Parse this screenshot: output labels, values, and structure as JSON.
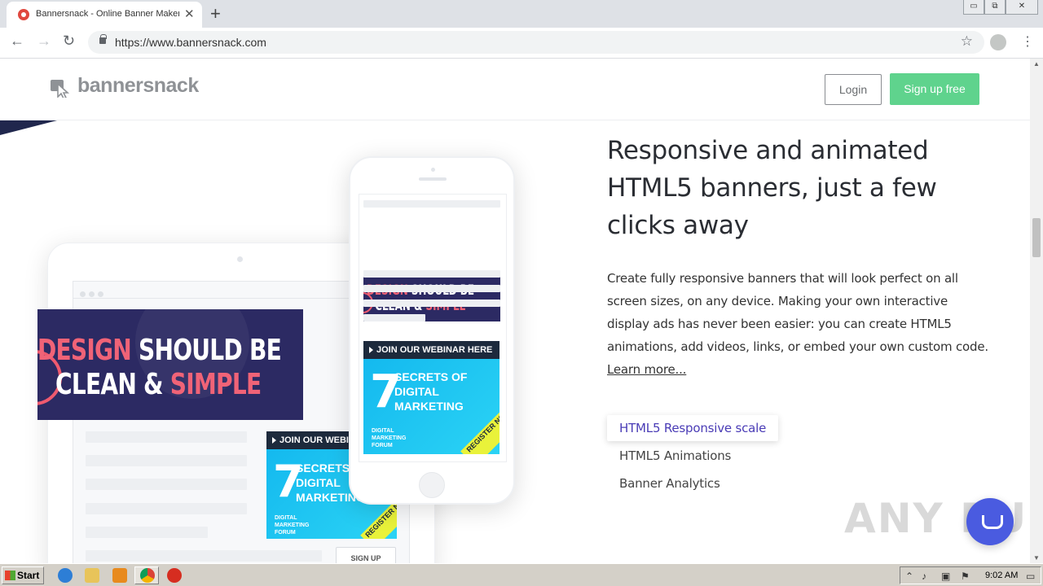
{
  "browser": {
    "tab_title": "Bannersnack - Online Banner Maker,",
    "tab_close": "✕",
    "new_tab": "+",
    "url": "https://www.bannersnack.com",
    "window_controls": [
      "▭",
      "⧉",
      "✕"
    ]
  },
  "site": {
    "logo_text": "bannersnack",
    "login_label": "Login",
    "signup_label": "Sign up free"
  },
  "mockups": {
    "banner_word_design": "DESIGN",
    "banner_text_should_be": " SHOULD BE",
    "banner_text_clean": "CLEAN & ",
    "banner_word_simple": "SIMPLE",
    "webinar_header": "JOIN OUR WEBINAR HERE",
    "webinar_header_short": "JOIN OUR WEBINAR",
    "webinar_number": "7",
    "webinar_secrets": [
      "SECRETS OF",
      "DIGITAL",
      "MARKETING"
    ],
    "webinar_forum": [
      "DIGITAL",
      "MARKETING",
      "FORUM"
    ],
    "webinar_register": "REGISTER NOW",
    "signup_button": "SIGN UP"
  },
  "hero": {
    "title": "Responsive and animated HTML5 banners, just a few clicks away",
    "body": "Create fully responsive banners that will look perfect on all screen sizes, on any device. Making your own interactive display ads has never been easier: you can create HTML5 animations, add videos, links, or embed your own custom code.",
    "learn_more": "Learn more..."
  },
  "features": [
    {
      "label": "HTML5 Responsive scale",
      "active": true
    },
    {
      "label": "HTML5 Animations",
      "active": false
    },
    {
      "label": "Banner Analytics",
      "active": false
    }
  ],
  "watermark": "ANY RUN",
  "taskbar": {
    "start_label": "Start",
    "clock": "9:02 AM"
  },
  "colors": {
    "accent_green": "#5fd38d",
    "banner_navy": "#2c2a63",
    "banner_pink": "#f06377",
    "feature_active": "#4a3cb6"
  }
}
